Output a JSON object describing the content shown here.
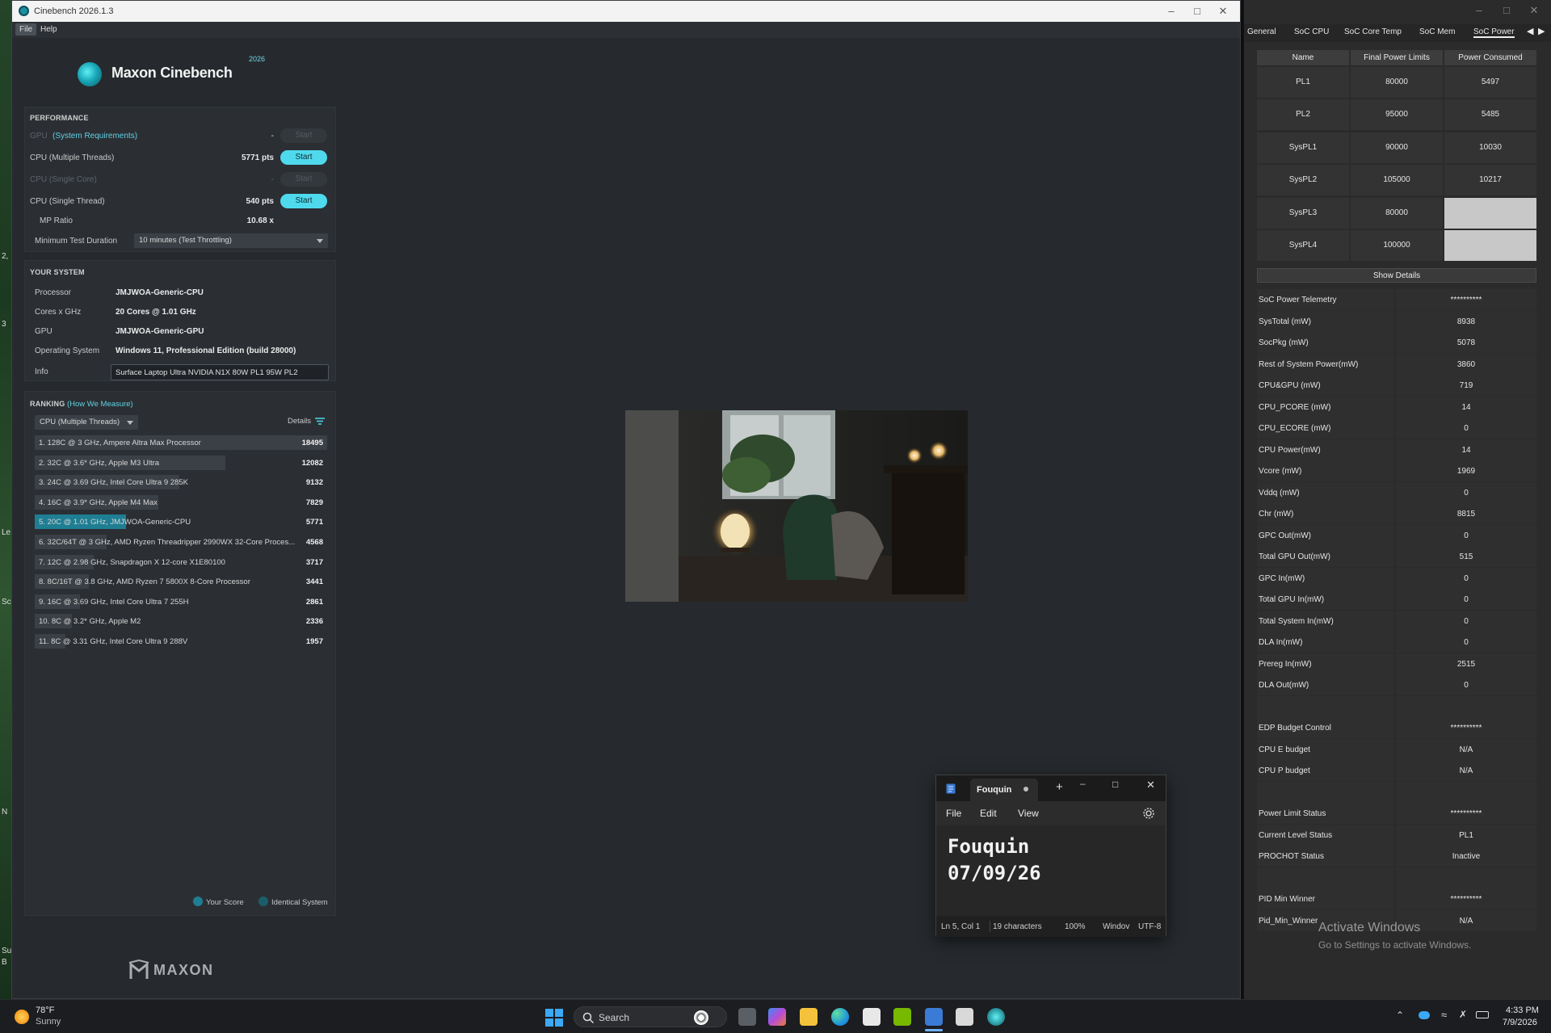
{
  "desktop": {
    "side_chars": [
      "2,",
      "3",
      "Le",
      "N",
      "Sc",
      "Su",
      "B"
    ]
  },
  "cinebench": {
    "window_title": "Cinebench 2026.1.3",
    "menu": [
      "File",
      "Help"
    ],
    "logo_text": "Maxon Cinebench",
    "logo_year": "2026",
    "performance": {
      "heading": "PERFORMANCE",
      "gpu_label": "GPU",
      "gpu_link": "(System Requirements)",
      "gpu_value": "-",
      "start_label": "Start",
      "cpu_multi_label": "CPU (Multiple Threads)",
      "cpu_multi_value": "5771 pts",
      "cpu_single_core_label": "CPU (Single Core)",
      "cpu_single_core_value": "-",
      "cpu_single_thread_label": "CPU (Single Thread)",
      "cpu_single_thread_value": "540 pts",
      "mp_ratio_label": "MP Ratio",
      "mp_ratio_value": "10.68 x",
      "min_duration_label": "Minimum Test Duration",
      "min_duration_value": "10 minutes (Test Throttling)"
    },
    "your_system": {
      "heading": "YOUR SYSTEM",
      "rows": [
        {
          "label": "Processor",
          "value": "JMJWOA-Generic-CPU"
        },
        {
          "label": "Cores x GHz",
          "value": "20 Cores @ 1.01 GHz"
        },
        {
          "label": "GPU",
          "value": "JMJWOA-Generic-GPU"
        },
        {
          "label": "Operating System",
          "value": "Windows 11, Professional Edition (build 28000)"
        }
      ],
      "info_label": "Info",
      "info_value": "Surface Laptop Ultra NVIDIA N1X 80W PL1 95W PL2"
    },
    "ranking": {
      "heading": "RANKING",
      "how_link": "(How We Measure)",
      "selector": "CPU (Multiple Threads)",
      "details": "Details",
      "items": [
        {
          "label": "1. 128C @ 3 GHz, Ampere Altra Max Processor",
          "score": "18495",
          "value": 18495
        },
        {
          "label": "2. 32C @ 3.6* GHz, Apple M3 Ultra",
          "score": "12082",
          "value": 12082
        },
        {
          "label": "3. 24C @ 3.69 GHz, Intel Core Ultra 9 285K",
          "score": "9132",
          "value": 9132
        },
        {
          "label": "4. 16C @ 3.9* GHz, Apple M4 Max",
          "score": "7829",
          "value": 7829
        },
        {
          "label": "5. 20C @ 1.01 GHz, JMJWOA-Generic-CPU",
          "score": "5771",
          "value": 5771,
          "you": true
        },
        {
          "label": "6. 32C/64T @ 3 GHz, AMD Ryzen Threadripper 2990WX 32-Core Proces...",
          "score": "4568",
          "value": 4568
        },
        {
          "label": "7. 12C @ 2.98 GHz, Snapdragon X 12-core X1E80100",
          "score": "3717",
          "value": 3717
        },
        {
          "label": "8. 8C/16T @ 3.8 GHz, AMD Ryzen 7 5800X 8-Core Processor",
          "score": "3441",
          "value": 3441
        },
        {
          "label": "9. 16C @ 3.69 GHz, Intel Core Ultra 7 255H",
          "score": "2861",
          "value": 2861
        },
        {
          "label": "10. 8C @ 3.2* GHz, Apple M2",
          "score": "2336",
          "value": 2336
        },
        {
          "label": "11. 8C @ 3.31 GHz, Intel Core Ultra 9 288V",
          "score": "1957",
          "value": 1957
        }
      ],
      "legend_your_score": "Your Score",
      "legend_identical": "Identical System"
    },
    "footer_logo": "MAXON"
  },
  "notepad": {
    "tab_title": "Fouquin",
    "menu": [
      "File",
      "Edit",
      "View"
    ],
    "content_line1": "Fouquin",
    "content_line2": "07/09/26",
    "status": {
      "position": "Ln 5, Col 1",
      "chars": "19 characters",
      "zoom": "100%",
      "eol": "Windov",
      "encoding": "UTF-8"
    }
  },
  "soc_window": {
    "tabs": [
      "General",
      "SoC CPU",
      "SoC Core Temp",
      "SoC Mem",
      "SoC Power"
    ],
    "active_tab": "SoC Power",
    "table_headers": [
      "Name",
      "Final Power Limits",
      "Power Consumed"
    ],
    "limits": [
      {
        "name": "PL1",
        "limit": "80000",
        "consumed": "5497"
      },
      {
        "name": "PL2",
        "limit": "95000",
        "consumed": "5485"
      },
      {
        "name": "SysPL1",
        "limit": "90000",
        "consumed": "10030"
      },
      {
        "name": "SysPL2",
        "limit": "105000",
        "consumed": "10217"
      },
      {
        "name": "SysPL3",
        "limit": "80000",
        "consumed": ""
      },
      {
        "name": "SysPL4",
        "limit": "100000",
        "consumed": ""
      }
    ],
    "show_details": "Show Details",
    "telemetry": [
      {
        "name": "SoC Power Telemetry",
        "value": "**********"
      },
      {
        "name": "SysTotal (mW)",
        "value": "8938"
      },
      {
        "name": "SocPkg (mW)",
        "value": "5078"
      },
      {
        "name": "Rest of System Power(mW)",
        "value": "3860"
      },
      {
        "name": "CPU&GPU (mW)",
        "value": "719"
      },
      {
        "name": "CPU_PCORE (mW)",
        "value": "14"
      },
      {
        "name": "CPU_ECORE (mW)",
        "value": "0"
      },
      {
        "name": "CPU Power(mW)",
        "value": "14"
      },
      {
        "name": "Vcore (mW)",
        "value": "1969"
      },
      {
        "name": "Vddq (mW)",
        "value": "0"
      },
      {
        "name": "Chr (mW)",
        "value": "8815"
      },
      {
        "name": "GPC Out(mW)",
        "value": "0"
      },
      {
        "name": "Total GPU Out(mW)",
        "value": "515"
      },
      {
        "name": "GPC In(mW)",
        "value": "0"
      },
      {
        "name": "Total GPU In(mW)",
        "value": "0"
      },
      {
        "name": "Total System In(mW)",
        "value": "0"
      },
      {
        "name": "DLA In(mW)",
        "value": "0"
      },
      {
        "name": "Prereg In(mW)",
        "value": "2515"
      },
      {
        "name": "DLA Out(mW)",
        "value": "0"
      },
      {
        "name": "",
        "value": ""
      },
      {
        "name": "EDP Budget Control",
        "value": "**********"
      },
      {
        "name": "CPU E budget",
        "value": "N/A"
      },
      {
        "name": "CPU P budget",
        "value": "N/A"
      },
      {
        "name": "",
        "value": ""
      },
      {
        "name": "Power Limit Status",
        "value": "**********"
      },
      {
        "name": "Current Level Status",
        "value": "PL1"
      },
      {
        "name": "PROCHOT Status",
        "value": "Inactive"
      },
      {
        "name": "",
        "value": ""
      },
      {
        "name": "PID Min Winner",
        "value": "**********"
      },
      {
        "name": "Pid_Min_Winner",
        "value": "N/A"
      }
    ],
    "activate_title": "Activate Windows",
    "activate_sub": "Go to Settings to activate Windows."
  },
  "taskbar": {
    "weather_temp": "78°F",
    "weather_cond": "Sunny",
    "search": "Search",
    "time": "4:33 PM",
    "date": "7/9/2026"
  },
  "colors": {
    "accent": "#4fd9ec",
    "your_score": "#1e7e93",
    "identical": "#1b5e6b"
  }
}
